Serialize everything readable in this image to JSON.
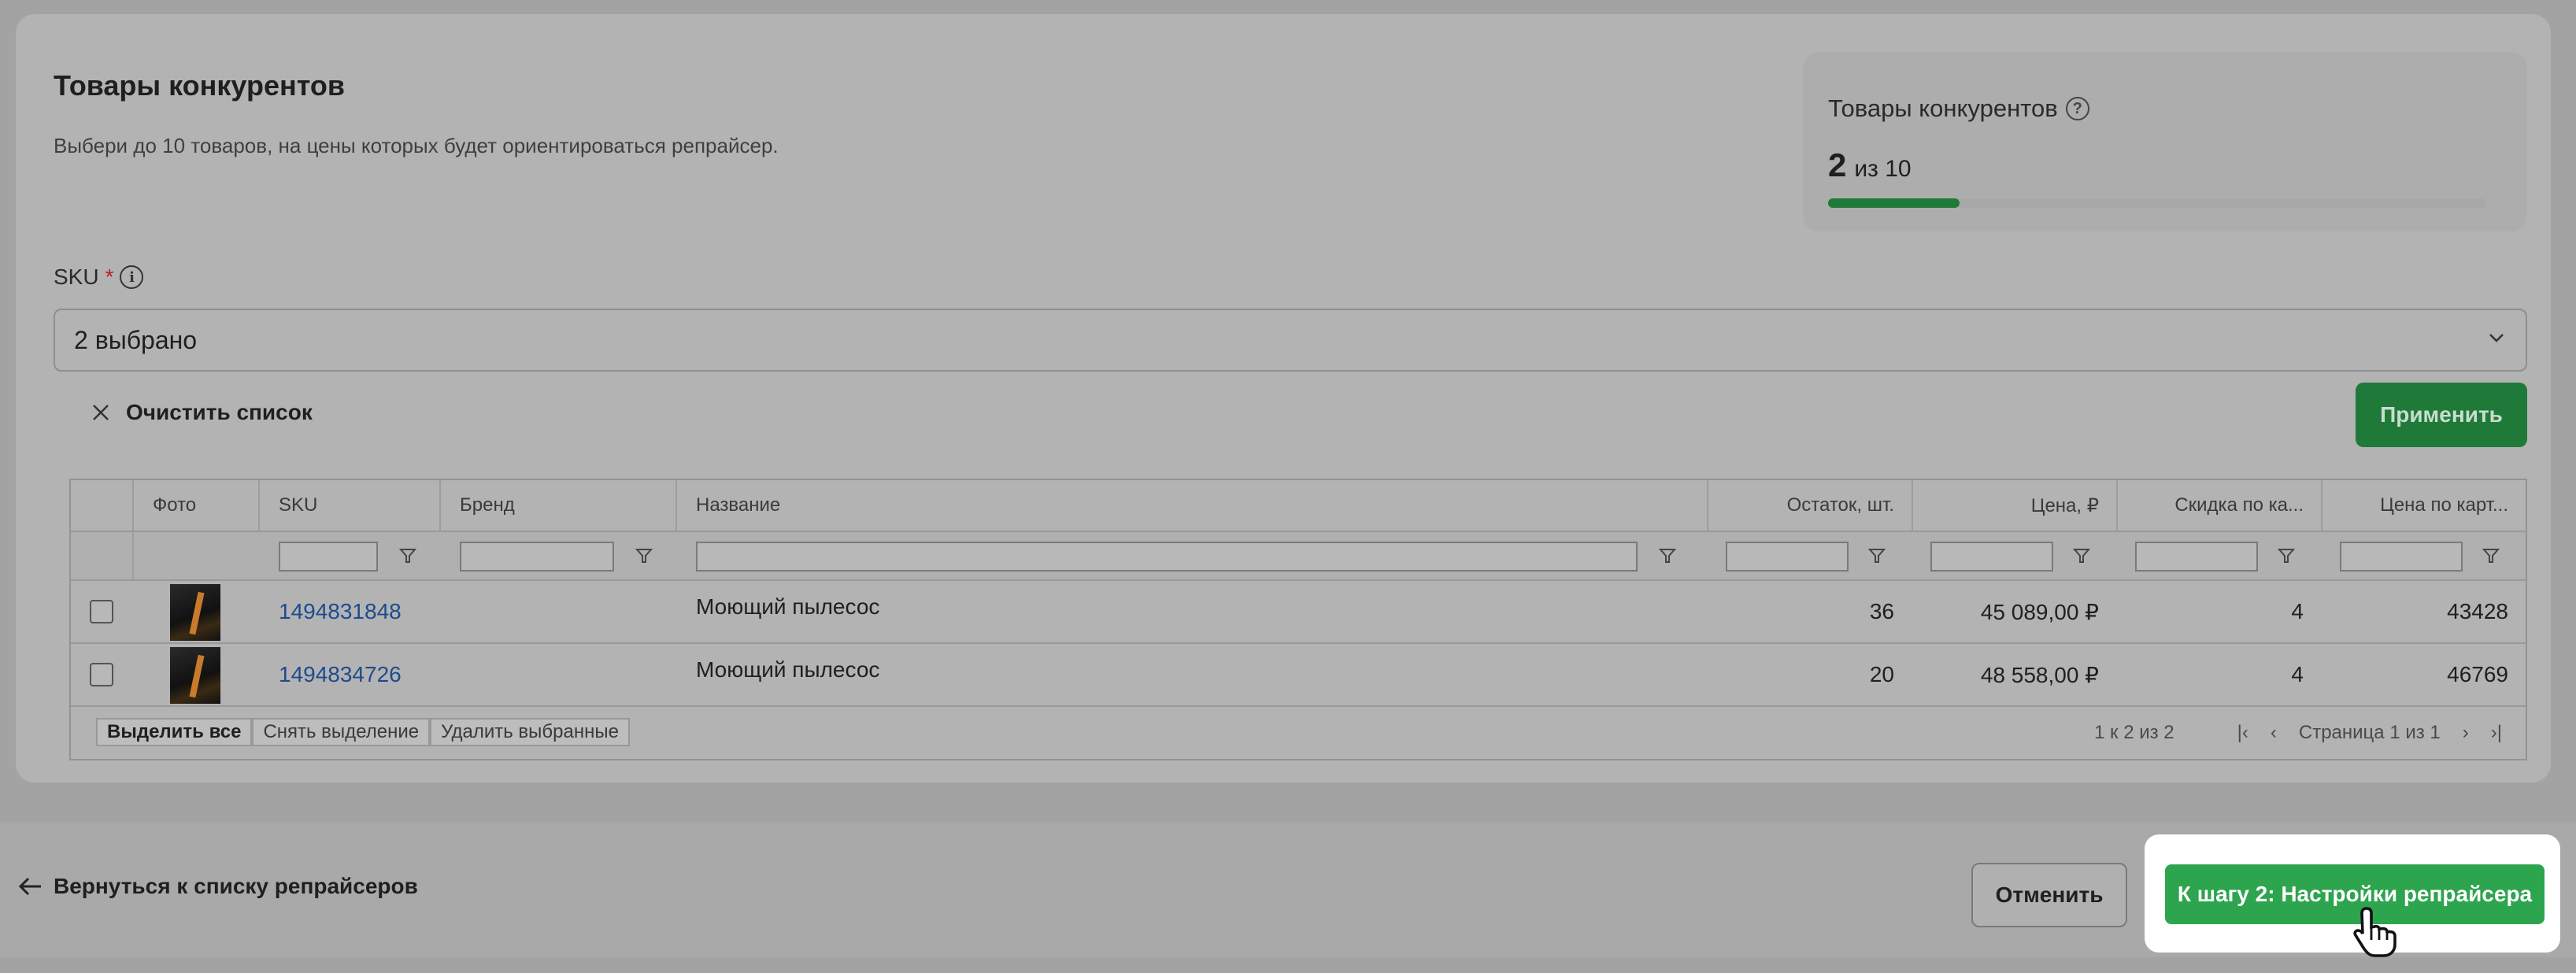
{
  "card": {
    "title": "Товары конкурентов",
    "subtitle": "Выбери до 10 товаров, на цены которых будет ориентироваться репрайсер."
  },
  "stats": {
    "title": "Товары конкурентов",
    "count": "2",
    "of_total": "из 10",
    "progress_fraction": 0.2
  },
  "sku_field": {
    "label": "SKU",
    "required_mark": "*",
    "value": "2 выбрано"
  },
  "actions": {
    "clear_label": "Очистить список",
    "apply_label": "Применить"
  },
  "grid": {
    "columns": {
      "photo": "Фото",
      "sku": "SKU",
      "brand": "Бренд",
      "name": "Название",
      "stock": "Остаток, шт.",
      "price": "Цена, ₽",
      "discount": "Скидка по ка...",
      "card_price": "Цена по карт..."
    },
    "rows": [
      {
        "sku": "1494831848",
        "brand": "",
        "name": "Моющий пылесос",
        "stock": "36",
        "price": "45 089,00 ₽",
        "discount": "4",
        "card_price": "43428"
      },
      {
        "sku": "1494834726",
        "brand": "",
        "name": "Моющий пылесос",
        "stock": "20",
        "price": "48 558,00 ₽",
        "discount": "4",
        "card_price": "46769"
      }
    ],
    "footer": {
      "select_all": "Выделить все",
      "deselect": "Снять выделение",
      "delete_selected": "Удалить выбранные",
      "range": "1 к 2 из 2",
      "page": "Страница 1 из 1"
    }
  },
  "bottom": {
    "back_label": "Вернуться к списку репрайсеров",
    "cancel_label": "Отменить",
    "next_label": "К шагу 2: Настройки репрайсера"
  },
  "colors": {
    "primary_green": "#2da44e",
    "link_blue": "#1d4b8f"
  }
}
